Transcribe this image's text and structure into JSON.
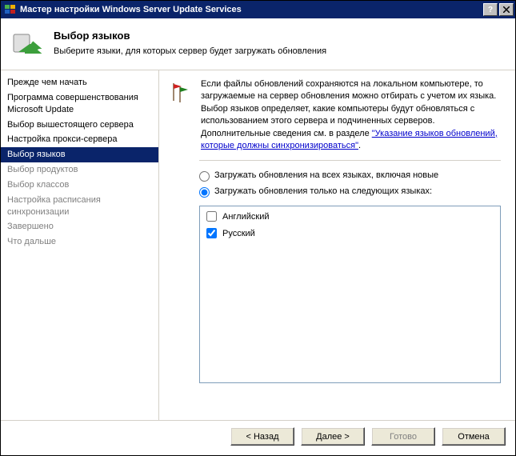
{
  "window": {
    "title": "Мастер настройки Windows Server Update Services"
  },
  "header": {
    "title": "Выбор языков",
    "subtitle": "Выберите языки, для которых сервер будет загружать обновления"
  },
  "sidebar": {
    "items": [
      {
        "label": "Прежде чем начать",
        "state": "completed"
      },
      {
        "label": "Программа совершенствования Microsoft Update",
        "state": "completed"
      },
      {
        "label": "Выбор вышестоящего сервера",
        "state": "completed"
      },
      {
        "label": "Настройка прокси-сервера",
        "state": "completed"
      },
      {
        "label": "Выбор языков",
        "state": "selected"
      },
      {
        "label": "Выбор продуктов",
        "state": "pending"
      },
      {
        "label": "Выбор классов",
        "state": "pending"
      },
      {
        "label": "Настройка расписания синхронизации",
        "state": "pending"
      },
      {
        "label": "Завершено",
        "state": "pending"
      },
      {
        "label": "Что дальше",
        "state": "pending"
      }
    ]
  },
  "main": {
    "body_text_1": "Если файлы обновлений сохраняются на локальном компьютере, то загружаемые на сервер обновления можно отбирать с учетом их языка. Выбор языков определяет, какие компьютеры будут обновляться с использованием этого сервера и подчиненных серверов. Дополнительные сведения см. в разделе ",
    "body_link": "\"Указание языков обновлений, которые должны синхронизироваться\"",
    "body_text_2": ".",
    "radio_all": "Загружать обновления на всех языках, включая новые",
    "radio_specific": "Загружать обновления только на следующих языках:",
    "radio_selected": "specific",
    "languages": [
      {
        "label": "Английский",
        "checked": false
      },
      {
        "label": "Русский",
        "checked": true
      }
    ]
  },
  "buttons": {
    "back": "< Назад",
    "next": "Далее >",
    "finish": "Готово",
    "cancel": "Отмена"
  }
}
